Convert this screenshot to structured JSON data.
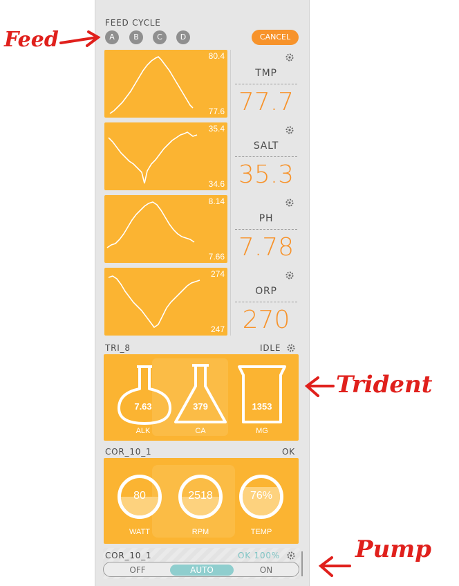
{
  "feed": {
    "title": "FEED CYCLE",
    "buttons": [
      "A",
      "B",
      "C",
      "D"
    ],
    "cancel": "CANCEL"
  },
  "sensors": [
    {
      "label": "TMP",
      "value": "77.7",
      "max": "80.4",
      "min": "77.6"
    },
    {
      "label": "SALT",
      "value": "35.3",
      "max": "35.4",
      "min": "34.6"
    },
    {
      "label": "PH",
      "value": "7.78",
      "max": "8.14",
      "min": "7.66"
    },
    {
      "label": "ORP",
      "value": "270",
      "max": "274",
      "min": "247"
    }
  ],
  "trident": {
    "title": "TRI_8",
    "status": "IDLE",
    "items": [
      {
        "value": "7.63",
        "unit": "ALK"
      },
      {
        "value": "379",
        "unit": "CA"
      },
      {
        "value": "1353",
        "unit": "MG"
      }
    ]
  },
  "cor": {
    "title": "COR_10_1",
    "status": "OK",
    "items": [
      {
        "value": "80",
        "unit": "WATT",
        "level": 0.5
      },
      {
        "value": "2518",
        "unit": "RPM",
        "level": 0.5
      },
      {
        "value": "76%",
        "unit": "TEMP",
        "level": 0.76
      }
    ]
  },
  "pump": {
    "title": "COR_10_1",
    "status": "OK 100%",
    "options": [
      "OFF",
      "AUTO",
      "ON"
    ],
    "selected": "AUTO"
  },
  "annotations": {
    "feed": "Feed",
    "trident": "Trident",
    "pump": "Pump"
  },
  "colors": {
    "accent": "#fbb432",
    "orange": "#f7932b",
    "annotation": "#e0201c"
  }
}
